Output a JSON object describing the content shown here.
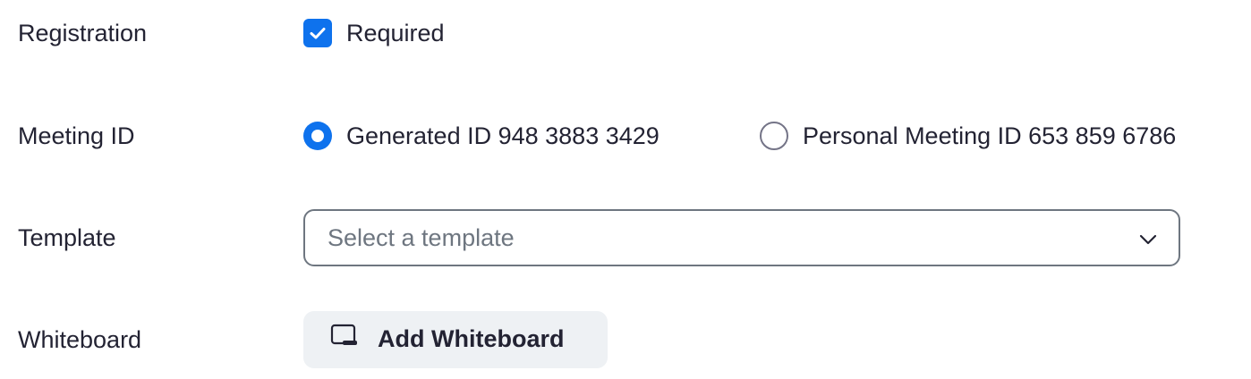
{
  "registration": {
    "label": "Registration",
    "checkbox_label": "Required",
    "checked": true
  },
  "meeting_id": {
    "label": "Meeting ID",
    "options": [
      {
        "label": "Generated ID 948 3883 3429",
        "selected": true
      },
      {
        "label": "Personal Meeting ID 653 859 6786",
        "selected": false
      }
    ]
  },
  "template": {
    "label": "Template",
    "placeholder": "Select a template"
  },
  "whiteboard": {
    "label": "Whiteboard",
    "button_label": "Add Whiteboard",
    "icon": "whiteboard-icon"
  },
  "colors": {
    "accent": "#0e72ed",
    "text": "#232333",
    "muted": "#6e7680",
    "button_bg": "#eef1f4"
  }
}
